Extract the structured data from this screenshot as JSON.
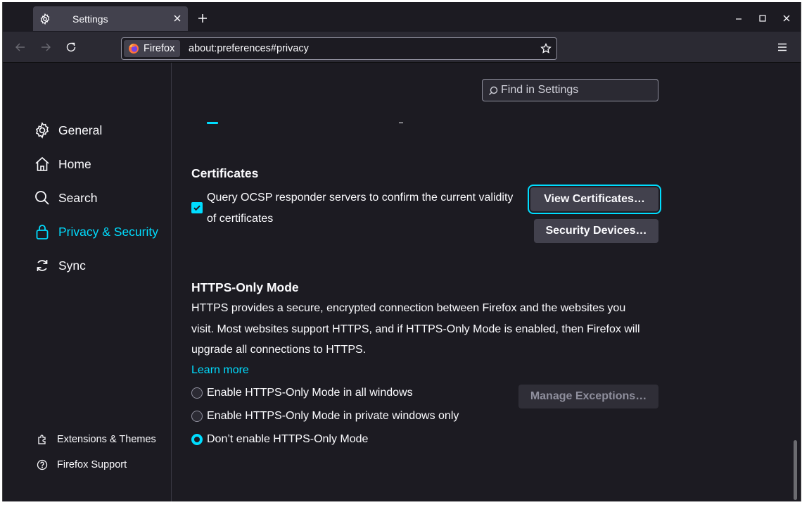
{
  "tab": {
    "title": "Settings"
  },
  "navbar": {
    "identity_label": "Firefox",
    "url": "about:preferences#privacy"
  },
  "sidebar": {
    "categories": [
      {
        "label": "General"
      },
      {
        "label": "Home"
      },
      {
        "label": "Search"
      },
      {
        "label": "Privacy & Security"
      },
      {
        "label": "Sync"
      }
    ],
    "footer": [
      {
        "label": "Extensions & Themes"
      },
      {
        "label": "Firefox Support"
      }
    ]
  },
  "search": {
    "placeholder": "Find in Settings"
  },
  "certificates": {
    "heading": "Certificates",
    "ocsp_line1": "Query OCSP responder servers to confirm the current validity",
    "ocsp_line2": "of certificates",
    "view_button": "View Certificates…",
    "devices_button": "Security Devices…"
  },
  "https_only": {
    "heading": "HTTPS-Only Mode",
    "desc1": "HTTPS provides a secure, encrypted connection between Firefox and the websites you",
    "desc2": "visit. Most websites support HTTPS, and if HTTPS-Only Mode is enabled, then Firefox will",
    "desc3": "upgrade all connections to HTTPS.",
    "learn_more": "Learn more",
    "manage_button": "Manage Exceptions…",
    "options": [
      {
        "label": "Enable HTTPS-Only Mode in all windows"
      },
      {
        "label": "Enable HTTPS-Only Mode in private windows only"
      },
      {
        "label": "Don’t enable HTTPS-Only Mode"
      }
    ]
  },
  "colors": {
    "accent": "#00ddff",
    "background": "#1c1b22",
    "toolbar": "#2b2a33"
  }
}
